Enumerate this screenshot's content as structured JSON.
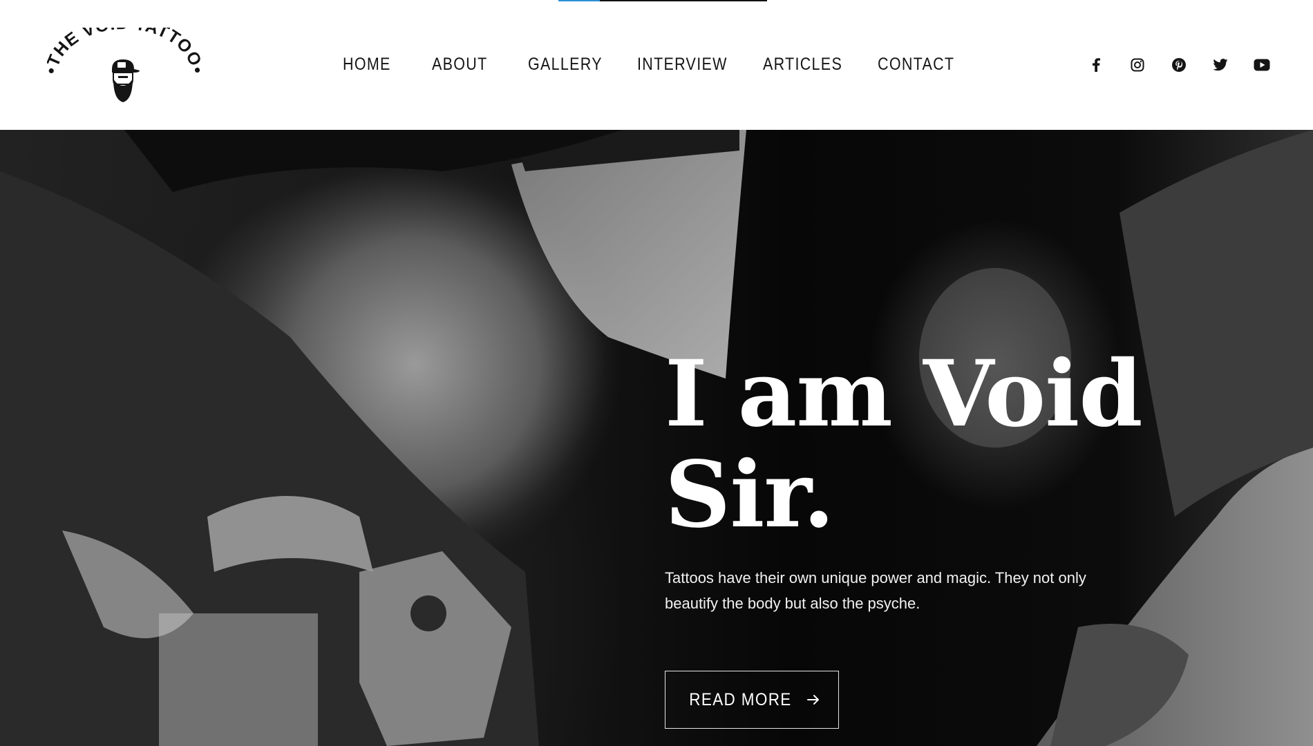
{
  "progress": {
    "value_percent": 20,
    "fill_color": "#2a8fd6",
    "track_color": "#111111"
  },
  "logo": {
    "text": "•THE VOID TATTOO•",
    "icon": "bearded-man-with-cap-icon"
  },
  "nav": {
    "items": [
      {
        "label": "HOME"
      },
      {
        "label": "ABOUT"
      },
      {
        "label": "GALLERY"
      },
      {
        "label": "INTERVIEW"
      },
      {
        "label": "ARTICLES"
      },
      {
        "label": "CONTACT"
      }
    ]
  },
  "social": {
    "icons": [
      "facebook-icon",
      "instagram-icon",
      "pinterest-icon",
      "twitter-icon",
      "youtube-icon"
    ]
  },
  "hero": {
    "title_line1": "I am Void",
    "title_line2": "Sir.",
    "description": "Tattoos have their own unique power and magic. They not only beautify the body but also the psyche.",
    "button_label": "READ MORE",
    "button_icon": "arrow-right-icon",
    "image": "grayscale-photo-of-tattoo-artist-working"
  },
  "colors": {
    "header_bg": "#ffffff",
    "text_dark": "#151515",
    "hero_text": "#ffffff"
  }
}
